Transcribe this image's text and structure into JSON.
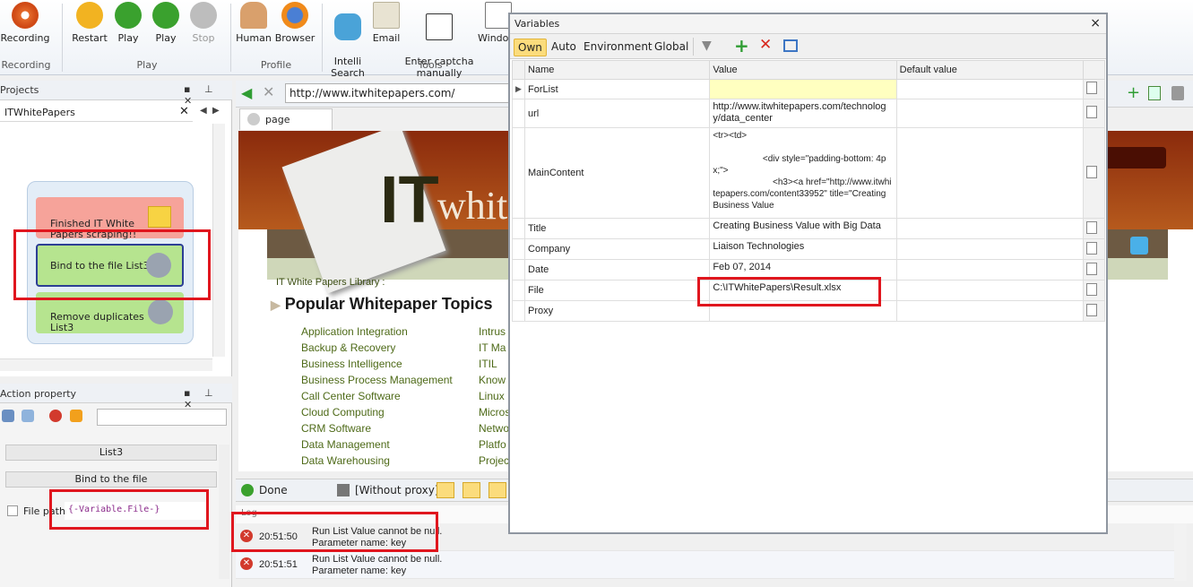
{
  "ribbon": {
    "buttons": [
      {
        "label": "Recording",
        "icon": "record-icon"
      },
      {
        "label": "Restart",
        "icon": "restart-icon"
      },
      {
        "label": "Play",
        "icon": "play-icon"
      },
      {
        "label": "Play",
        "icon": "play-step-icon"
      },
      {
        "label": "Stop",
        "icon": "stop-icon"
      },
      {
        "label": "Human",
        "icon": "human-icon"
      },
      {
        "label": "Browser",
        "icon": "browser-icon"
      },
      {
        "label": "Intelli\nSearch",
        "icon": "intelli-search-icon"
      },
      {
        "label": "Email",
        "icon": "email-icon"
      },
      {
        "label": "Enter captcha\nmanually",
        "icon": "captcha-icon"
      },
      {
        "label": "Windo",
        "icon": "window-icon"
      }
    ],
    "groups": {
      "recording": "Recording",
      "play": "Play",
      "profile": "Profile",
      "tools": "Tools"
    }
  },
  "projects": {
    "title": "Projects",
    "tab": "ITWhitePapers",
    "nodes": [
      {
        "label": "Finished IT White\nPapers scraping!!"
      },
      {
        "label": "Bind to the file List3"
      },
      {
        "label": "Remove duplicates\nList3"
      }
    ]
  },
  "action_property": {
    "title": "Action property",
    "field1": "List3",
    "field2": "Bind to the file",
    "file_path_label": "File path",
    "file_path_value": "{-Variable.File-}"
  },
  "browser": {
    "url": "http://www.itwhitepapers.com/",
    "tab": "page",
    "logo_it": "IT",
    "logo_rest": "whit",
    "library": "IT White Papers Library :",
    "heading": "Popular Whitepaper Topics",
    "topics_left": [
      "Application Integration",
      "Backup & Recovery",
      "Business Intelligence",
      "Business Process Management",
      "Call Center Software",
      "Cloud Computing",
      "CRM Software",
      "Data Management",
      "Data Warehousing"
    ],
    "topics_right": [
      "Intrus",
      "IT Ma",
      "ITIL",
      "Know",
      "Linux",
      "Micros",
      "Netwo",
      "Platfo",
      "Projec"
    ],
    "status": "Done",
    "proxy": "[Without proxy]"
  },
  "log": {
    "header": "Log",
    "rows": [
      {
        "time": "20:51:50",
        "line1": "Run List  Value cannot be null.",
        "line2": "Parameter name: key"
      },
      {
        "time": "20:51:51",
        "line1": "Run List  Value cannot be null.",
        "line2": "Parameter name: key"
      }
    ]
  },
  "variables": {
    "title": "Variables",
    "close": "×",
    "tabs": [
      "Own",
      "Auto",
      "Environment",
      "Global"
    ],
    "columns": [
      "Name",
      "Value",
      "Default value"
    ],
    "rows": [
      {
        "name": "ForList",
        "value": "",
        "default": ""
      },
      {
        "name": "url",
        "value": "http://www.itwhitepapers.com/technology/data_center",
        "default": ""
      },
      {
        "name": "MainContent",
        "value": "<tr><td>\n\n                    <div style=\"padding-bottom: 4px;\">\n                        <h3><a href=\"http://www.itwhitepapers.com/content33952\" title=\"Creating Business Value",
        "default": ""
      },
      {
        "name": "Title",
        "value": "Creating Business Value with Big Data",
        "default": ""
      },
      {
        "name": "Company",
        "value": "Liaison Technologies",
        "default": ""
      },
      {
        "name": "Date",
        "value": "Feb 07, 2014",
        "default": ""
      },
      {
        "name": "File",
        "value": "C:\\ITWhitePapers\\Result.xlsx",
        "default": ""
      },
      {
        "name": "Proxy",
        "value": "",
        "default": ""
      }
    ]
  },
  "colors": {
    "highlight": "#e0161e",
    "tab_active": "#fbdc7c",
    "node_green": "#b6e48f",
    "node_red": "#f6a39a",
    "forlist_yellow": "#ffffc0"
  }
}
